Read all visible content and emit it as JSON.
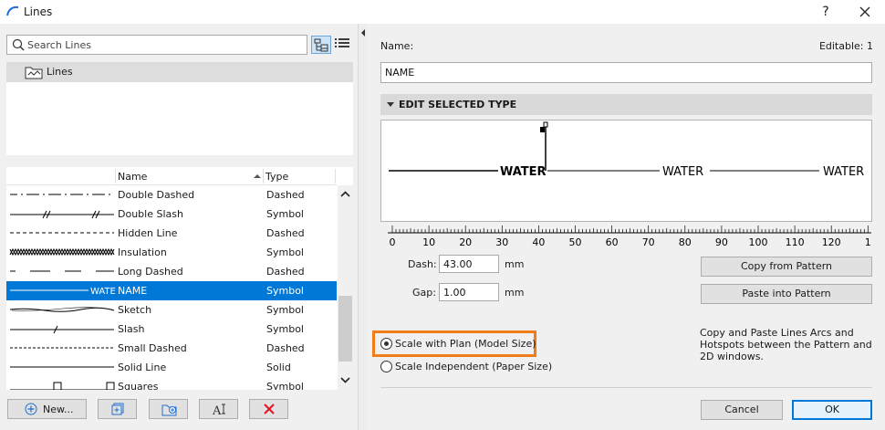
{
  "window": {
    "title": "Lines",
    "help_label": "?",
    "icons": {
      "app": "arc-icon",
      "close": "close-icon"
    }
  },
  "search": {
    "placeholder": "Search Lines",
    "value": ""
  },
  "folder": {
    "label": "Lines"
  },
  "list": {
    "columns": {
      "name": "Name",
      "type": "Type"
    },
    "rows": [
      {
        "name": "Double Dashed",
        "type": "Dashed",
        "preview": "double-dashed",
        "selected": false
      },
      {
        "name": "Double Slash",
        "type": "Symbol",
        "preview": "double-slash",
        "selected": false
      },
      {
        "name": "Hidden Line",
        "type": "Dashed",
        "preview": "hidden",
        "selected": false
      },
      {
        "name": "Insulation",
        "type": "Symbol",
        "preview": "insulation",
        "selected": false
      },
      {
        "name": "Long Dashed",
        "type": "Dashed",
        "preview": "long-dashed",
        "selected": false
      },
      {
        "name": "NAME",
        "type": "Symbol",
        "preview": "water",
        "selected": true,
        "preview_text": "WATE"
      },
      {
        "name": "Sketch",
        "type": "Symbol",
        "preview": "sketch",
        "selected": false
      },
      {
        "name": "Slash",
        "type": "Symbol",
        "preview": "slash",
        "selected": false
      },
      {
        "name": "Small Dashed",
        "type": "Dashed",
        "preview": "small-dashed",
        "selected": false
      },
      {
        "name": "Solid Line",
        "type": "Solid",
        "preview": "solid",
        "selected": false
      },
      {
        "name": "Squares",
        "type": "Symbol",
        "preview": "squares",
        "selected": false
      }
    ]
  },
  "buttons": {
    "new_label": "New..."
  },
  "editor": {
    "name_label": "Name:",
    "editable_label": "Editable: 1",
    "name_value": "NAME",
    "section_title": "EDIT SELECTED TYPE",
    "preview_label_text": "WATER",
    "ruler_labels": [
      "0",
      "10",
      "20",
      "30",
      "40",
      "50",
      "60",
      "70",
      "80",
      "90",
      "100",
      "110",
      "120",
      "1"
    ],
    "dash_label": "Dash:",
    "dash_value": "43.00",
    "gap_label": "Gap:",
    "gap_value": "1.00",
    "unit": "mm",
    "copy_btn": "Copy from Pattern",
    "paste_btn": "Paste into Pattern",
    "help_lines": [
      "Copy and Paste Lines Arcs and",
      "Hotspots between the Pattern and",
      "2D windows."
    ],
    "radio_plan": "Scale with Plan (Model Size)",
    "radio_plan_checked": true,
    "radio_indep": "Scale Independent (Paper Size)",
    "radio_indep_checked": false
  },
  "footer": {
    "cancel": "Cancel",
    "ok": "OK"
  },
  "colors": {
    "selection": "#0078d7",
    "highlight": "#f07d1a",
    "delete_icon": "#e81123"
  }
}
